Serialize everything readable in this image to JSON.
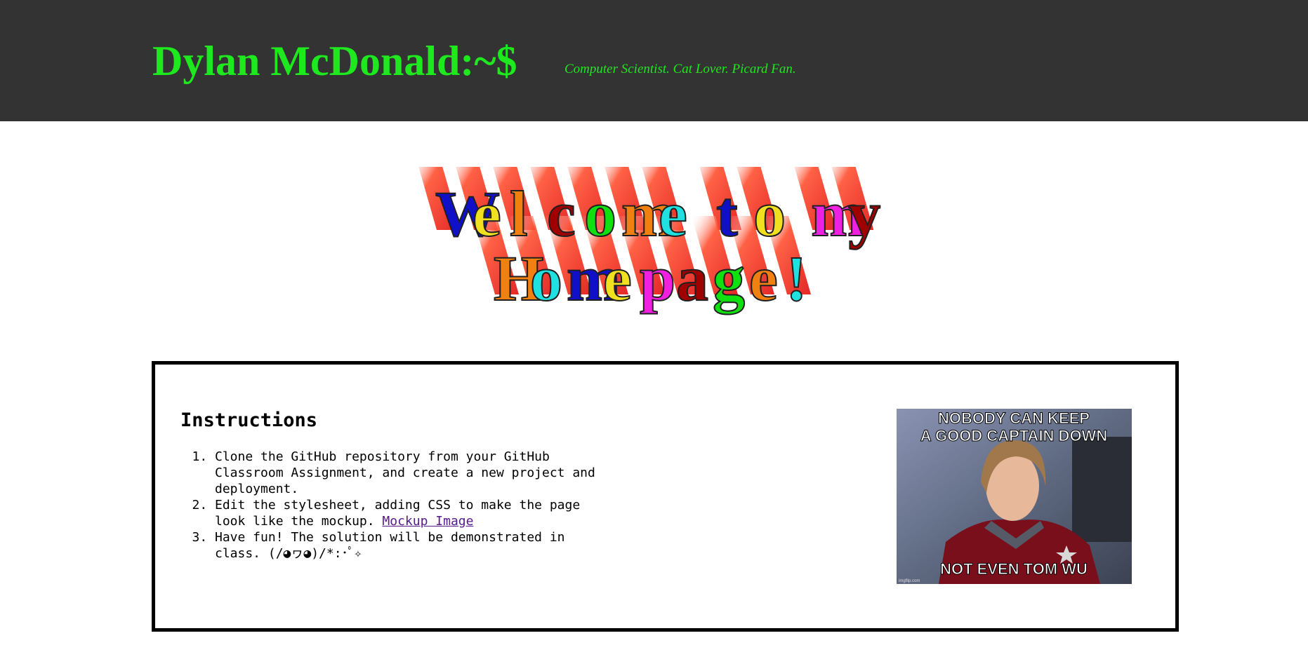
{
  "header": {
    "title": "Dylan McDonald:~$",
    "tagline": "Computer Scientist. Cat Lover. Picard Fan."
  },
  "banner": {
    "line1": [
      {
        "ch": "W",
        "color": "#1010c8"
      },
      {
        "ch": "e",
        "color": "#f0e020"
      },
      {
        "ch": "l",
        "color": "#f08010"
      },
      {
        "ch": "c",
        "color": "#a00000"
      },
      {
        "ch": "o",
        "color": "#10e010"
      },
      {
        "ch": "m",
        "color": "#f08010"
      },
      {
        "ch": "e",
        "color": "#20e0e0"
      },
      {
        "ch": " ",
        "color": "#000000"
      },
      {
        "ch": "t",
        "color": "#1010c8"
      },
      {
        "ch": "o",
        "color": "#f0e020"
      },
      {
        "ch": " ",
        "color": "#000000"
      },
      {
        "ch": "m",
        "color": "#f020e0"
      },
      {
        "ch": "y",
        "color": "#a00000"
      }
    ],
    "line2": [
      {
        "ch": "H",
        "color": "#f08010"
      },
      {
        "ch": "o",
        "color": "#20e0e0"
      },
      {
        "ch": "m",
        "color": "#1010c8"
      },
      {
        "ch": "e",
        "color": "#f0e020"
      },
      {
        "ch": "p",
        "color": "#f020e0"
      },
      {
        "ch": "a",
        "color": "#a00000"
      },
      {
        "ch": "g",
        "color": "#10e010"
      },
      {
        "ch": "e",
        "color": "#f08010"
      },
      {
        "ch": "!",
        "color": "#20e0e0"
      }
    ]
  },
  "instructions": {
    "title": "Instructions",
    "steps": [
      {
        "text": "Clone the GitHub repository from your GitHub Classroom Assignment, and create a new project and deployment."
      },
      {
        "text": "Edit the stylesheet, adding CSS to make the page look like the mockup. ",
        "link": "Mockup Image"
      },
      {
        "text": "Have fun! The solution will be demonstrated in class. (/◕ヮ◕)/*:･ﾟ✧"
      }
    ]
  },
  "meme": {
    "top_line1": "NOBODY CAN KEEP",
    "top_line2": "A GOOD CAPTAIN DOWN",
    "bottom": "NOT EVEN TOM WU",
    "watermark": "imgflip.com"
  }
}
